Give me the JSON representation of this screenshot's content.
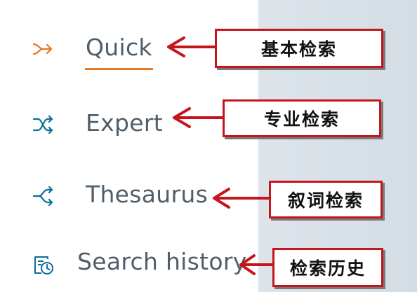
{
  "menu": {
    "items": [
      {
        "label": "Quick",
        "icon": "quick-arrow-icon",
        "active": true
      },
      {
        "label": "Expert",
        "icon": "shuffle-icon",
        "active": false
      },
      {
        "label": "Thesaurus",
        "icon": "branch-arrows-icon",
        "active": false
      },
      {
        "label": "Search history",
        "icon": "history-document-icon",
        "active": false
      }
    ]
  },
  "annotations": [
    {
      "text": "基本检索"
    },
    {
      "text": "专业检索"
    },
    {
      "text": "叙词检索"
    },
    {
      "text": "检索历史"
    }
  ],
  "colors": {
    "active_accent": "#e87722",
    "icon_blue": "#0a6e99",
    "label_gray": "#4f5e6b",
    "annotation_red": "#c4161c"
  }
}
